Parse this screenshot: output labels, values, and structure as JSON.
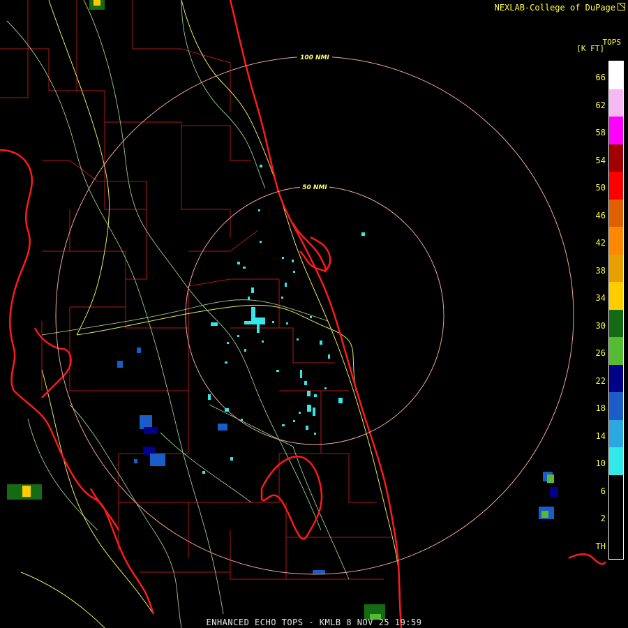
{
  "header": {
    "credit": "NEXLAB-College of DuPage",
    "credit_icon": "logo-icon"
  },
  "legend": {
    "title": "TOPS",
    "units": "[K FT]",
    "labels": [
      "66",
      "62",
      "58",
      "54",
      "50",
      "46",
      "42",
      "38",
      "34",
      "30",
      "26",
      "22",
      "18",
      "14",
      "10",
      "6",
      "2",
      "TH"
    ],
    "colors": [
      "#ffffff",
      "#f5b8f0",
      "#ff00ff",
      "#a00000",
      "#ff0000",
      "#e06000",
      "#ff8800",
      "#e8a000",
      "#ffcc00",
      "#146b14",
      "#55bb33",
      "#000088",
      "#1a5cc8",
      "#2ba8e0",
      "#33e8e8",
      "#000000"
    ]
  },
  "range_rings": [
    {
      "label": "100 NMI"
    },
    {
      "label": "50 NMI"
    }
  ],
  "footer": {
    "product": "ENHANCED ECHO TOPS - KMLB 8 NOV 25 19:59"
  }
}
